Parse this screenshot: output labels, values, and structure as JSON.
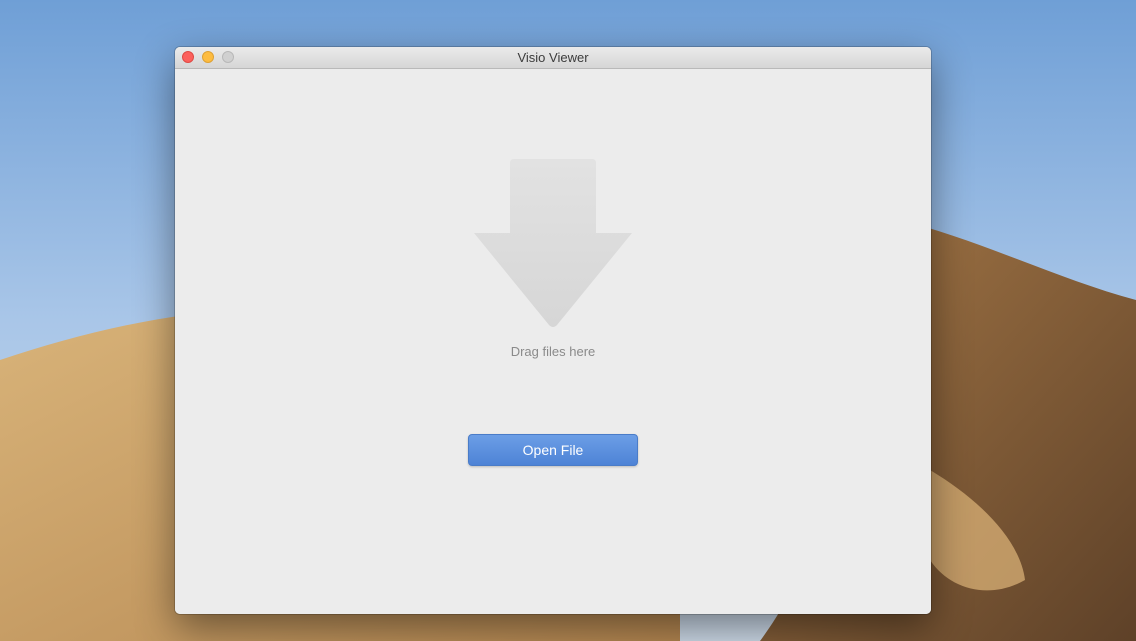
{
  "window": {
    "title": "Visio Viewer"
  },
  "traffic_lights": {
    "close_icon": "close-icon",
    "minimize_icon": "minimize-icon",
    "zoom_icon": "zoom-icon"
  },
  "main": {
    "drop_icon": "download-arrow-icon",
    "drop_label": "Drag files here",
    "open_button_label": "Open File"
  },
  "colors": {
    "accent": "#5a8fe0",
    "close": "#fc605c",
    "minimize": "#fdbc40"
  }
}
